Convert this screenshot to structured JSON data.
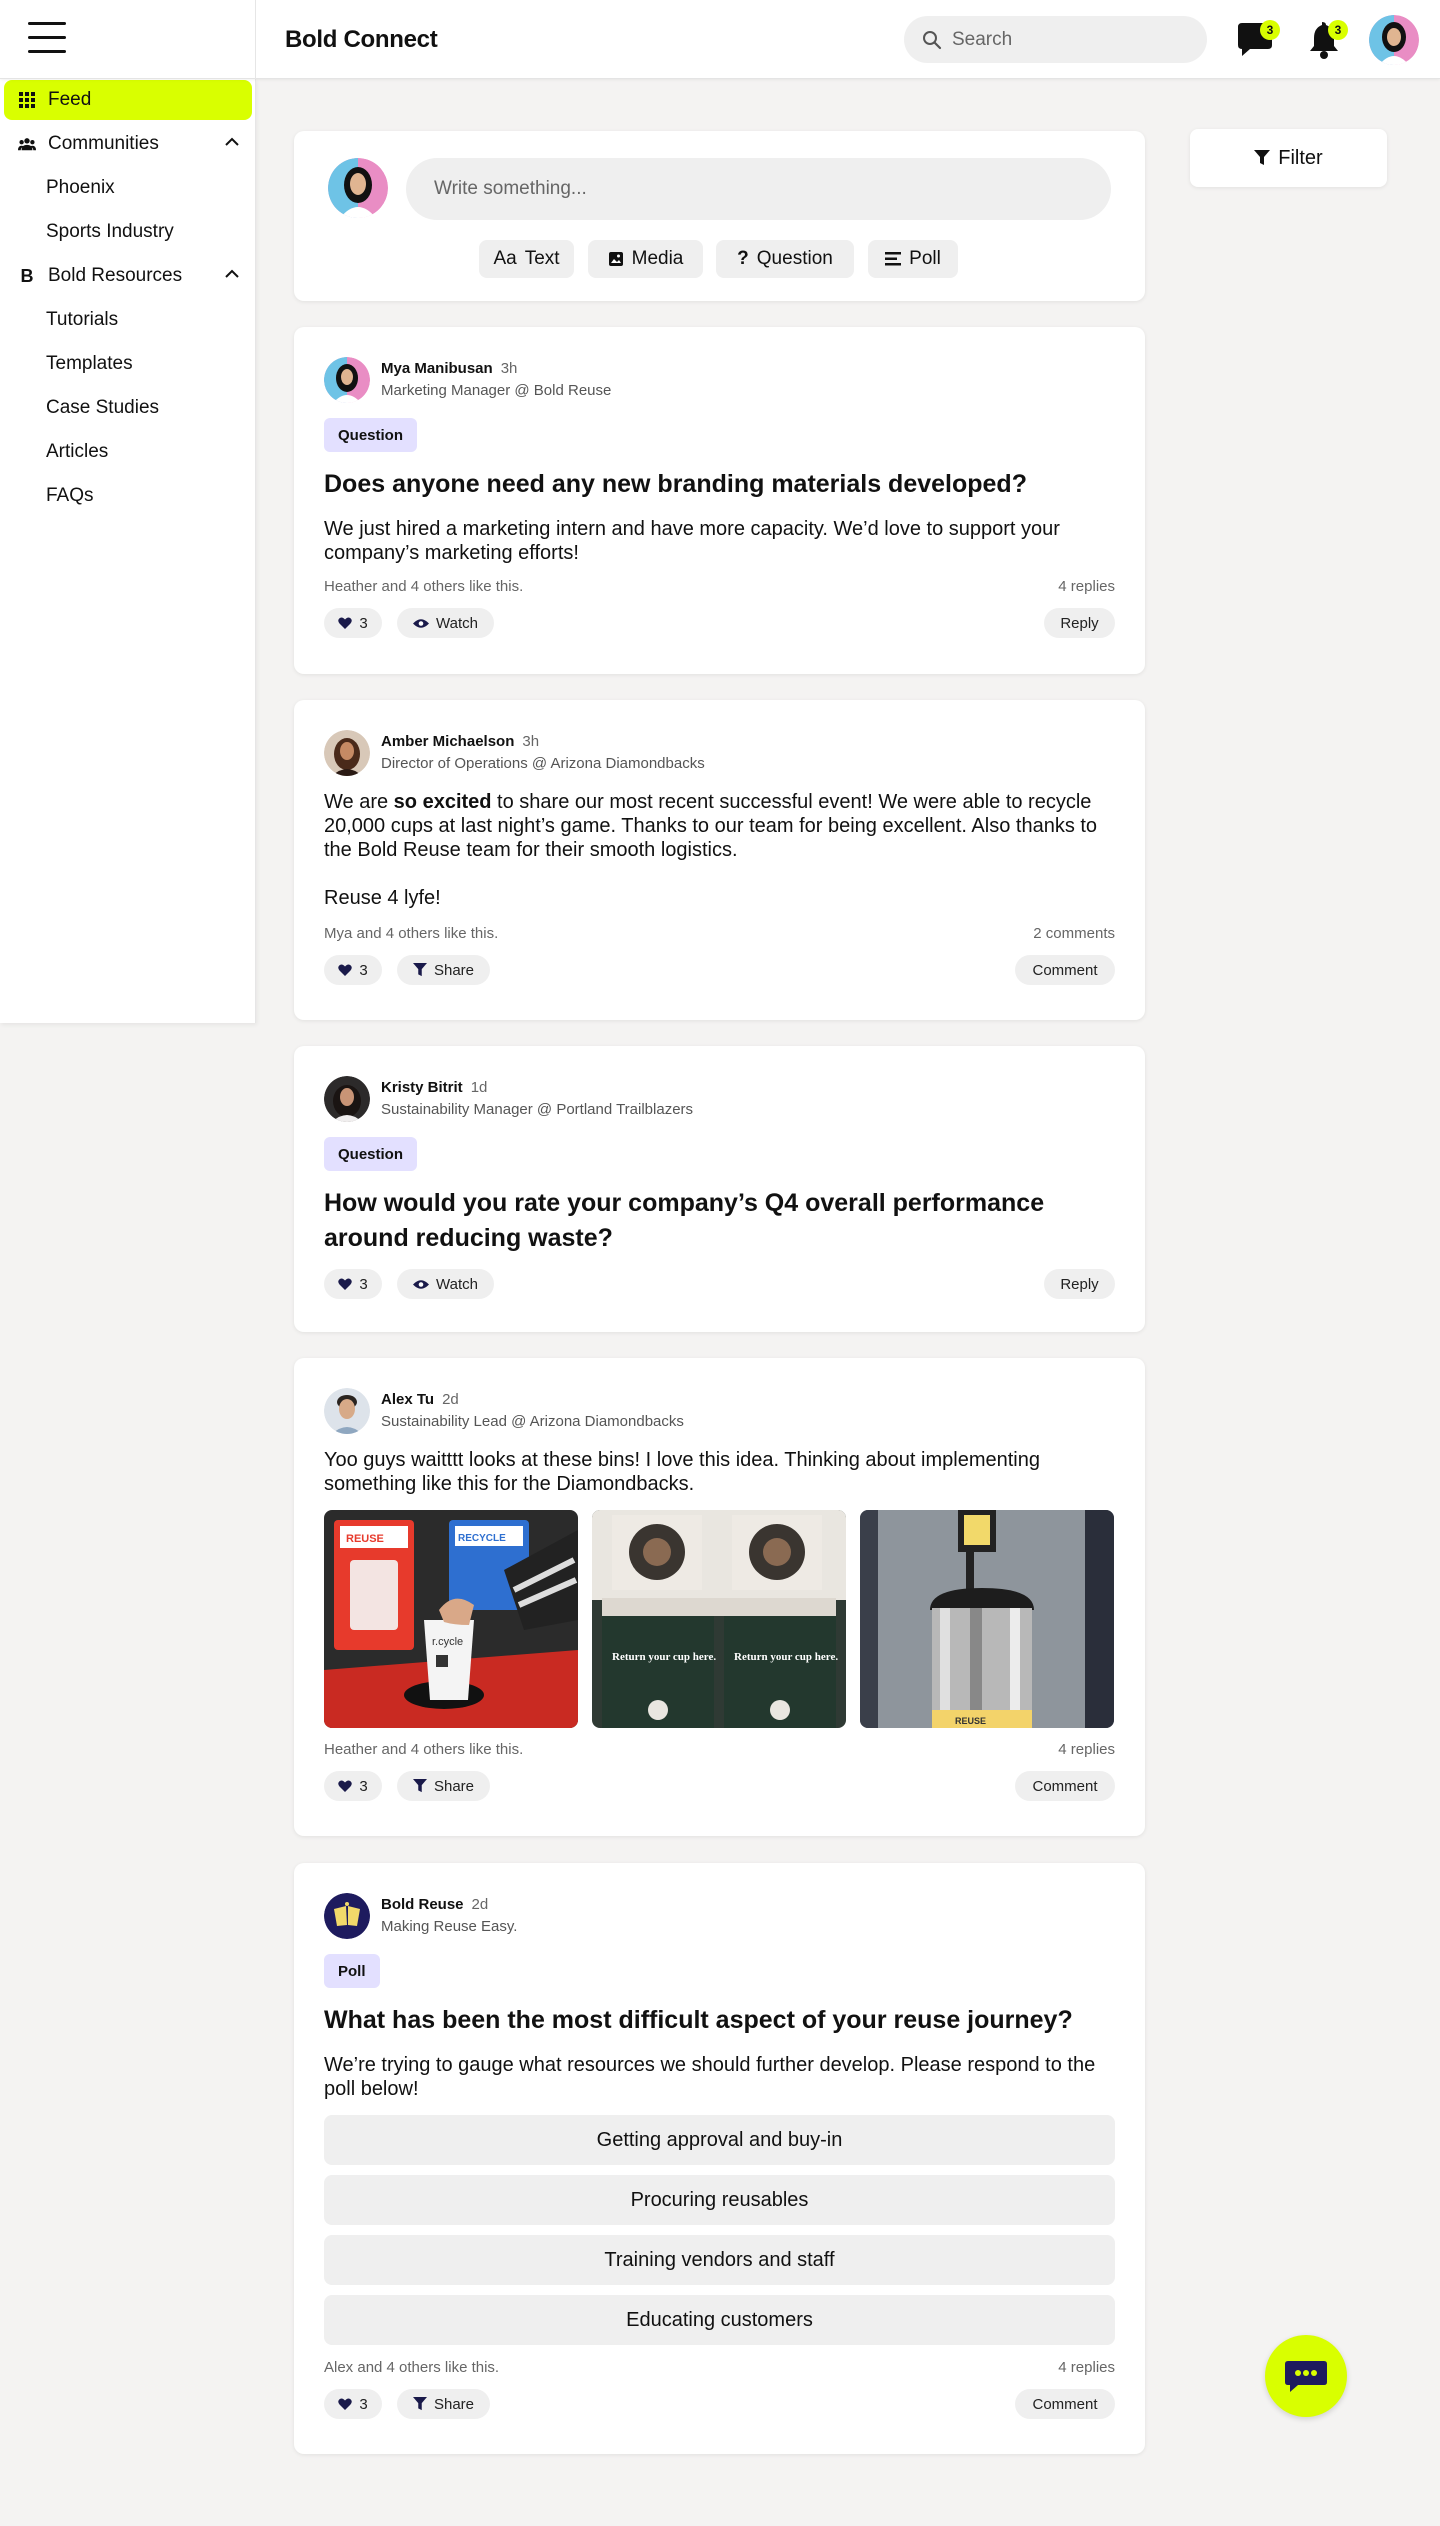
{
  "header": {
    "brand": "Bold Connect",
    "search_placeholder": "Search",
    "messages_count": "3",
    "notifications_count": "3"
  },
  "sidebar": {
    "feed": "Feed",
    "communities": "Communities",
    "community_items": [
      "Phoenix",
      "Sports Industry"
    ],
    "resources": "Bold Resources",
    "resource_items": [
      "Tutorials",
      "Templates",
      "Case Studies",
      "Articles",
      "FAQs"
    ]
  },
  "composer": {
    "placeholder": "Write something...",
    "types": [
      "Text",
      "Media",
      "Question",
      "Poll"
    ],
    "text_prefix": "Aa"
  },
  "filter_label": "Filter",
  "posts": [
    {
      "name": "Mya Manibusan",
      "time": "3h",
      "role": "Marketing Manager @ Bold Reuse",
      "tag": "Question",
      "title": "Does anyone need any new branding materials developed?",
      "body": "We just hired a marketing intern and have more capacity. We’d love to support your company’s marketing efforts!",
      "likes_text": "Heather and 4 others like this.",
      "count_text": "4 replies",
      "like_count": "3",
      "secondary": "Watch",
      "action": "Reply"
    },
    {
      "name": "Amber Michaelson",
      "time": "3h",
      "role": "Director of Operations @ Arizona Diamondbacks",
      "body_pre": "We are ",
      "body_bold": "so excited",
      "body_post": " to share our most recent successful event! We were able to recycle 20,000 cups at last night’s game. Thanks to our team for being excellent. Also thanks to the Bold Reuse team for their smooth logistics.",
      "body2": "Reuse 4 lyfe!",
      "likes_text": "Mya and 4 others like this.",
      "count_text": "2 comments",
      "like_count": "3",
      "secondary": "Share",
      "action": "Comment"
    },
    {
      "name": "Kristy Bitrit",
      "time": "1d",
      "role": "Sustainability Manager @ Portland Trailblazers",
      "tag": "Question",
      "title": "How would you rate your company’s Q4 overall performance around reducing waste?",
      "like_count": "3",
      "secondary": "Watch",
      "action": "Reply"
    },
    {
      "name": "Alex Tu",
      "time": "2d",
      "role": "Sustainability Lead @ Arizona Diamondbacks",
      "body": "Yoo guys waitttt looks at these bins! I love this idea. Thinking about implementing something like this for the Diamondbacks.",
      "images": {
        "img1_reuse": "REUSE",
        "img1_recycle": "RECYCLE",
        "img1_cup": "r.cycle",
        "img2_sign": "Return your cup here.",
        "img3_base": "REUSE"
      },
      "likes_text": "Heather and 4 others like this.",
      "count_text": "4 replies",
      "like_count": "3",
      "secondary": "Share",
      "action": "Comment"
    },
    {
      "name": "Bold Reuse",
      "time": "2d",
      "role": "Making Reuse Easy.",
      "tag": "Poll",
      "title": "What has been the most difficult aspect of your reuse journey?",
      "body": "We’re trying to gauge what resources we should further develop. Please respond to the poll below!",
      "options": [
        "Getting approval and buy-in",
        "Procuring reusables",
        "Training vendors and staff",
        "Educating customers"
      ],
      "likes_text": "Alex and 4 others like this.",
      "count_text": "4 replies",
      "like_count": "3",
      "secondary": "Share",
      "action": "Comment"
    }
  ],
  "icons": [
    "hamburger-icon",
    "chat-bubble-icon",
    "bell-icon",
    "grid-icon",
    "people-icon",
    "b-logo-icon",
    "chevron-up-icon",
    "search-icon",
    "image-icon",
    "question-icon",
    "list-icon",
    "filter-icon",
    "heart-icon",
    "eye-icon"
  ],
  "colors": {
    "accent": "#d9ff00",
    "tag_bg": "#e3e0ff",
    "pill_bg": "#efefef"
  }
}
